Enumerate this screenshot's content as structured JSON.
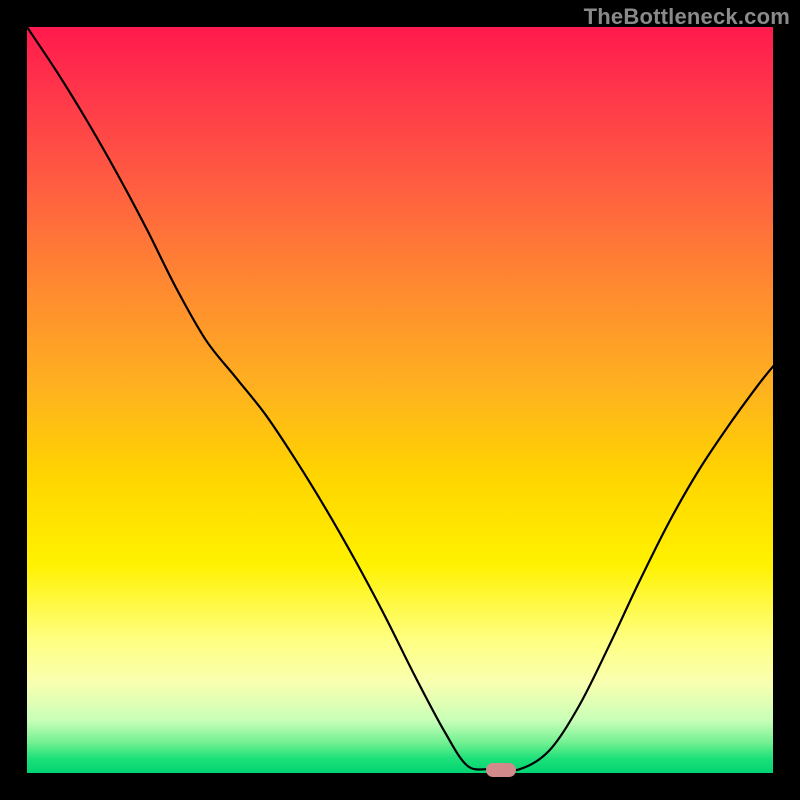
{
  "watermark": "TheBottleneck.com",
  "marker": {
    "x_frac": 0.636,
    "y_frac": 0.996
  },
  "colors": {
    "frame": "#000000",
    "curve": "#000000",
    "marker": "#d38a8a",
    "watermark": "#8a8a8a"
  },
  "chart_data": {
    "type": "line",
    "title": "",
    "xlabel": "",
    "ylabel": "",
    "xlim": [
      0,
      1
    ],
    "ylim": [
      0,
      1
    ],
    "series": [
      {
        "name": "bottleneck-curve",
        "x": [
          0.0,
          0.04,
          0.08,
          0.12,
          0.16,
          0.2,
          0.24,
          0.28,
          0.32,
          0.36,
          0.4,
          0.44,
          0.48,
          0.52,
          0.56,
          0.59,
          0.62,
          0.66,
          0.7,
          0.74,
          0.78,
          0.82,
          0.86,
          0.9,
          0.94,
          0.98,
          1.0
        ],
        "y": [
          1.0,
          0.94,
          0.875,
          0.805,
          0.73,
          0.65,
          0.58,
          0.53,
          0.48,
          0.42,
          0.355,
          0.285,
          0.21,
          0.13,
          0.055,
          0.01,
          0.005,
          0.005,
          0.03,
          0.09,
          0.17,
          0.255,
          0.335,
          0.405,
          0.465,
          0.52,
          0.545
        ]
      }
    ],
    "annotations": [
      {
        "type": "marker",
        "x": 0.636,
        "y": 0.004,
        "shape": "pill",
        "color": "#d38a8a"
      }
    ]
  }
}
